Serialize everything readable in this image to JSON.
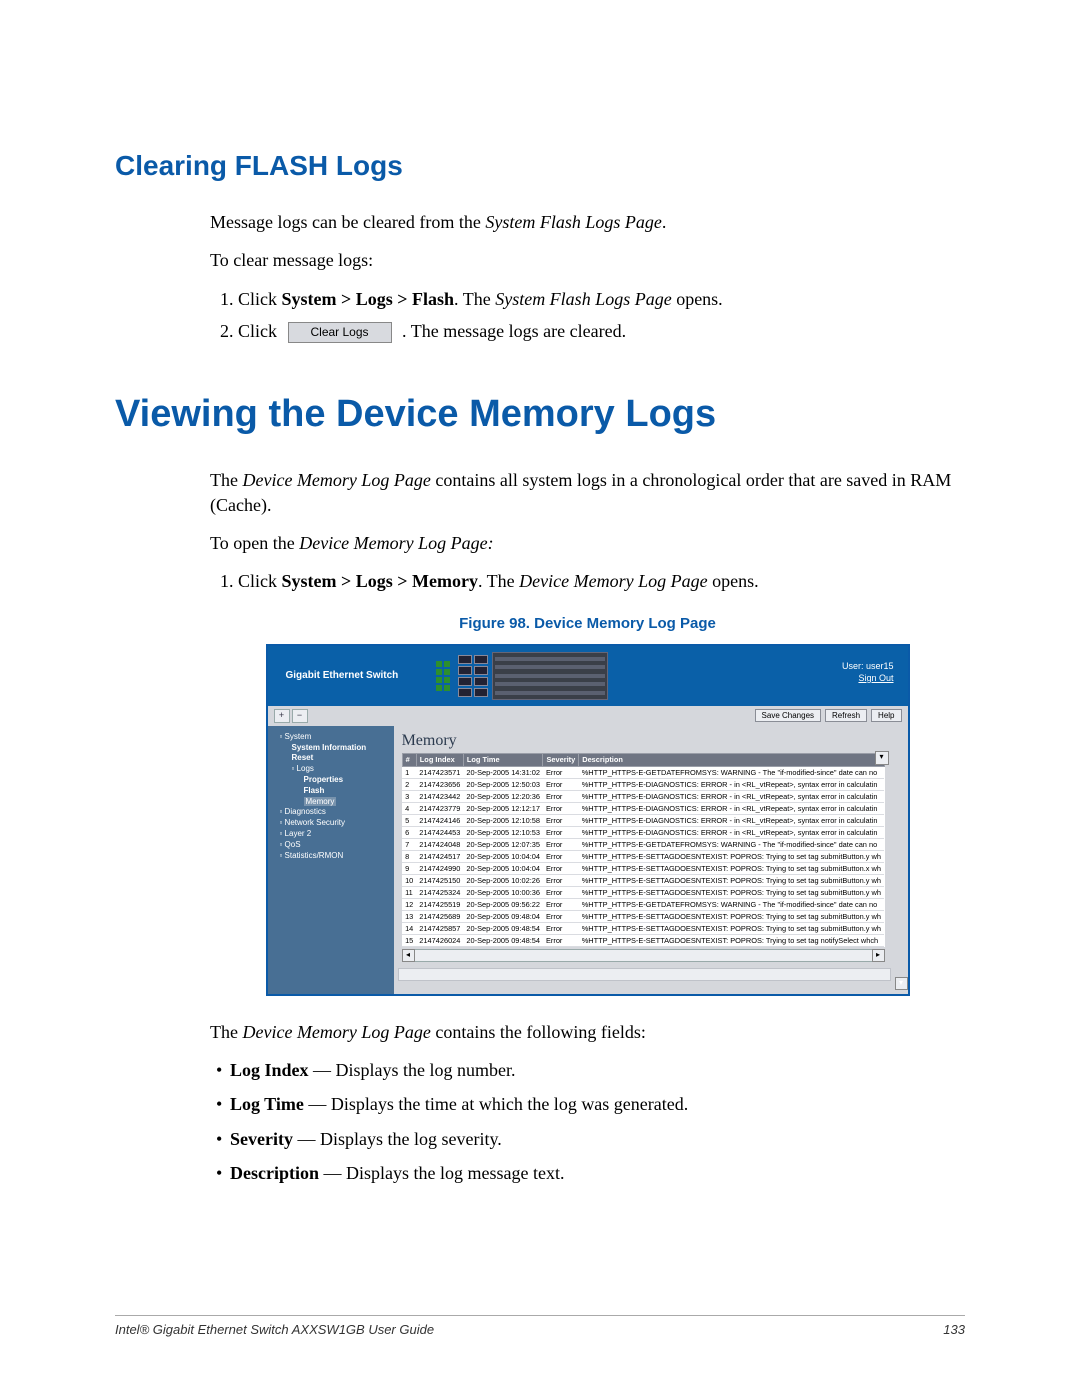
{
  "section1_title": "Clearing FLASH Logs",
  "s1_p1a": "Message logs can be cleared from the ",
  "s1_p1b": "System Flash Logs Page",
  "s1_p1c": ".",
  "s1_p2": "To clear message logs:",
  "s1_li1a": "Click ",
  "s1_li1b": "System > Logs > Flash",
  "s1_li1c": ". The ",
  "s1_li1d": "System Flash Logs Page",
  "s1_li1e": " opens.",
  "s1_li2a": "Click",
  "s1_li2b": ". The message logs are cleared.",
  "clear_logs_btn": "Clear Logs",
  "main_title": "Viewing the Device Memory Logs",
  "m_p1a": "The ",
  "m_p1b": "Device Memory Log Page",
  "m_p1c": " contains all system logs in a chronological order that are saved in RAM (Cache).",
  "m_p2a": "To open the ",
  "m_p2b": "Device Memory Log Page:",
  "m_li1a": "Click ",
  "m_li1b": "System > Logs > Memory",
  "m_li1c": ". The ",
  "m_li1d": "Device Memory Log Page",
  "m_li1e": " opens.",
  "fig_caption": "Figure 98. Device Memory Log Page",
  "app": {
    "brand": "Gigabit Ethernet Switch",
    "user_label": "User: user15",
    "signout": "Sign Out",
    "btn_save": "Save Changes",
    "btn_refresh": "Refresh",
    "btn_help": "Help",
    "panel_title": "Memory",
    "cols": {
      "num": "#",
      "idx": "Log Index",
      "time": "Log Time",
      "sev": "Severity",
      "desc": "Description"
    },
    "tree": [
      {
        "label": "System",
        "lvl": 0,
        "bold": false,
        "box": true,
        "sel": false
      },
      {
        "label": "System Information",
        "lvl": 1,
        "bold": true,
        "box": false,
        "sel": false
      },
      {
        "label": "Reset",
        "lvl": 1,
        "bold": true,
        "box": false,
        "sel": false
      },
      {
        "label": "Logs",
        "lvl": 1,
        "bold": false,
        "box": true,
        "sel": false
      },
      {
        "label": "Properties",
        "lvl": 2,
        "bold": true,
        "box": false,
        "sel": false
      },
      {
        "label": "Flash",
        "lvl": 2,
        "bold": true,
        "box": false,
        "sel": false
      },
      {
        "label": "Memory",
        "lvl": 2,
        "bold": false,
        "box": false,
        "sel": true
      },
      {
        "label": "Diagnostics",
        "lvl": 0,
        "bold": false,
        "box": true,
        "sel": false
      },
      {
        "label": "Network Security",
        "lvl": 0,
        "bold": false,
        "box": true,
        "sel": false
      },
      {
        "label": "Layer 2",
        "lvl": 0,
        "bold": false,
        "box": true,
        "sel": false
      },
      {
        "label": "QoS",
        "lvl": 0,
        "bold": false,
        "box": true,
        "sel": false
      },
      {
        "label": "Statistics/RMON",
        "lvl": 0,
        "bold": false,
        "box": true,
        "sel": false
      }
    ],
    "rows": [
      {
        "n": "1",
        "idx": "2147423571",
        "time": "20-Sep-2005 14:31:02",
        "sev": "Error",
        "desc": "%HTTP_HTTPS-E-GETDATEFROMSYS: WARNING - The \"if-modified-since\" date can no"
      },
      {
        "n": "2",
        "idx": "2147423656",
        "time": "20-Sep-2005 12:50:03",
        "sev": "Error",
        "desc": "%HTTP_HTTPS-E-DIAGNOSTICS: ERROR - in <RL_vtRepeat>, syntax error in calculatin"
      },
      {
        "n": "3",
        "idx": "2147423442",
        "time": "20-Sep-2005 12:20:36",
        "sev": "Error",
        "desc": "%HTTP_HTTPS-E-DIAGNOSTICS: ERROR - in <RL_vtRepeat>, syntax error in calculatin"
      },
      {
        "n": "4",
        "idx": "2147423779",
        "time": "20-Sep-2005 12:12:17",
        "sev": "Error",
        "desc": "%HTTP_HTTPS-E-DIAGNOSTICS: ERROR - in <RL_vtRepeat>, syntax error in calculatin"
      },
      {
        "n": "5",
        "idx": "2147424146",
        "time": "20-Sep-2005 12:10:58",
        "sev": "Error",
        "desc": "%HTTP_HTTPS-E-DIAGNOSTICS: ERROR - in <RL_vtRepeat>, syntax error in calculatin"
      },
      {
        "n": "6",
        "idx": "2147424453",
        "time": "20-Sep-2005 12:10:53",
        "sev": "Error",
        "desc": "%HTTP_HTTPS-E-DIAGNOSTICS: ERROR - in <RL_vtRepeat>, syntax error in calculatin"
      },
      {
        "n": "7",
        "idx": "2147424048",
        "time": "20-Sep-2005 12:07:35",
        "sev": "Error",
        "desc": "%HTTP_HTTPS-E-GETDATEFROMSYS: WARNING - The \"if-modified-since\" date can no"
      },
      {
        "n": "8",
        "idx": "2147424517",
        "time": "20-Sep-2005 10:04:04",
        "sev": "Error",
        "desc": "%HTTP_HTTPS-E-SETTAGDOESNTEXIST: POPROS: Trying to set tag submitButton.y wh"
      },
      {
        "n": "9",
        "idx": "2147424990",
        "time": "20-Sep-2005 10:04:04",
        "sev": "Error",
        "desc": "%HTTP_HTTPS-E-SETTAGDOESNTEXIST: POPROS: Trying to set tag submitButton.x wh"
      },
      {
        "n": "10",
        "idx": "2147425150",
        "time": "20-Sep-2005 10:02:26",
        "sev": "Error",
        "desc": "%HTTP_HTTPS-E-SETTAGDOESNTEXIST: POPROS: Trying to set tag submitButton.y wh"
      },
      {
        "n": "11",
        "idx": "2147425324",
        "time": "20-Sep-2005 10:00:36",
        "sev": "Error",
        "desc": "%HTTP_HTTPS-E-SETTAGDOESNTEXIST: POPROS: Trying to set tag submitButton.y wh"
      },
      {
        "n": "12",
        "idx": "2147425519",
        "time": "20-Sep-2005 09:56:22",
        "sev": "Error",
        "desc": "%HTTP_HTTPS-E-GETDATEFROMSYS: WARNING - The \"if-modified-since\" date can no"
      },
      {
        "n": "13",
        "idx": "2147425689",
        "time": "20-Sep-2005 09:48:04",
        "sev": "Error",
        "desc": "%HTTP_HTTPS-E-SETTAGDOESNTEXIST: POPROS: Trying to set tag submitButton.y wh"
      },
      {
        "n": "14",
        "idx": "2147425857",
        "time": "20-Sep-2005 09:48:54",
        "sev": "Error",
        "desc": "%HTTP_HTTPS-E-SETTAGDOESNTEXIST: POPROS: Trying to set tag submitButton.y wh"
      },
      {
        "n": "15",
        "idx": "2147426024",
        "time": "20-Sep-2005 09:48:54",
        "sev": "Error",
        "desc": "%HTTP_HTTPS-E-SETTAGDOESNTEXIST: POPROS: Trying to set tag notifySelect whch"
      }
    ]
  },
  "post_p1a": "The ",
  "post_p1b": "Device Memory Log Page",
  "post_p1c": " contains the following fields:",
  "fields": [
    {
      "name": "Log Index",
      "desc": " — Displays the log number."
    },
    {
      "name": "Log Time",
      "desc": " — Displays the time at which the log was generated."
    },
    {
      "name": "Severity",
      "desc": " — Displays the log severity."
    },
    {
      "name": "Description",
      "desc": " — Displays the log message text."
    }
  ],
  "footer_left": "Intel® Gigabit Ethernet Switch AXXSW1GB User Guide",
  "footer_right": "133"
}
